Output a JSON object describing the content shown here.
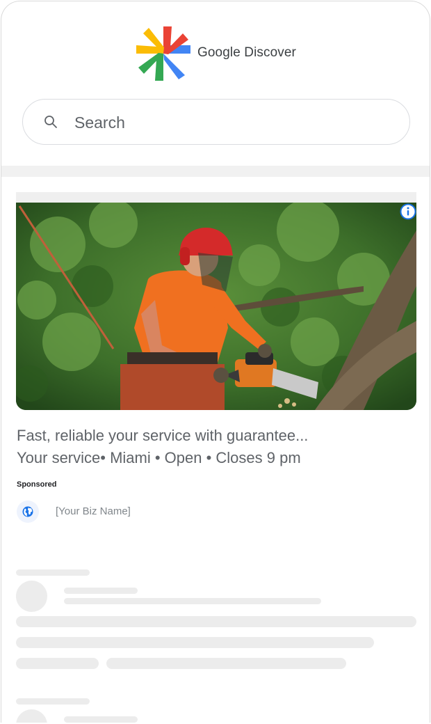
{
  "header": {
    "logo_text": "Google Discover",
    "logo_icon": "google-discover-asterisk-icon",
    "brand_colors": [
      "#4285F4",
      "#EA4335",
      "#FBBC05",
      "#34A853"
    ]
  },
  "search": {
    "placeholder": "Search",
    "icon": "search-icon"
  },
  "ad": {
    "image_description_icon": "photo",
    "info_icon": "info-icon",
    "info_color": "#1a73e8",
    "headline": "Fast, reliable your service with guarantee...",
    "details": "Your service• Miami • Open • Closes 9 pm",
    "sponsored_label": "Sponsored",
    "business_name": "[Your Biz Name]",
    "business_icon": "globe-icon"
  }
}
